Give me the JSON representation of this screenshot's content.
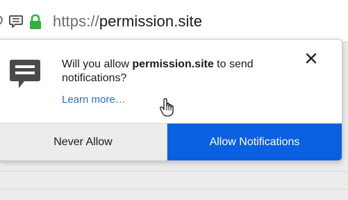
{
  "urlbar": {
    "scheme": "https://",
    "host": "permission.site"
  },
  "popup": {
    "message_prefix": "Will you allow ",
    "message_site": "permission.site",
    "message_suffix": " to send notifications?",
    "learn_more": "Learn more…",
    "never_allow_label": "Never Allow",
    "allow_label": "Allow Notifications"
  },
  "colors": {
    "allow_button": "#0a60e0",
    "link": "#2a6fce",
    "lock": "#2fb239"
  },
  "icons": {
    "site_info": "info-icon",
    "notification": "notification-icon",
    "lock": "lock-icon",
    "close": "close-icon",
    "cursor": "hand-pointer-icon"
  }
}
